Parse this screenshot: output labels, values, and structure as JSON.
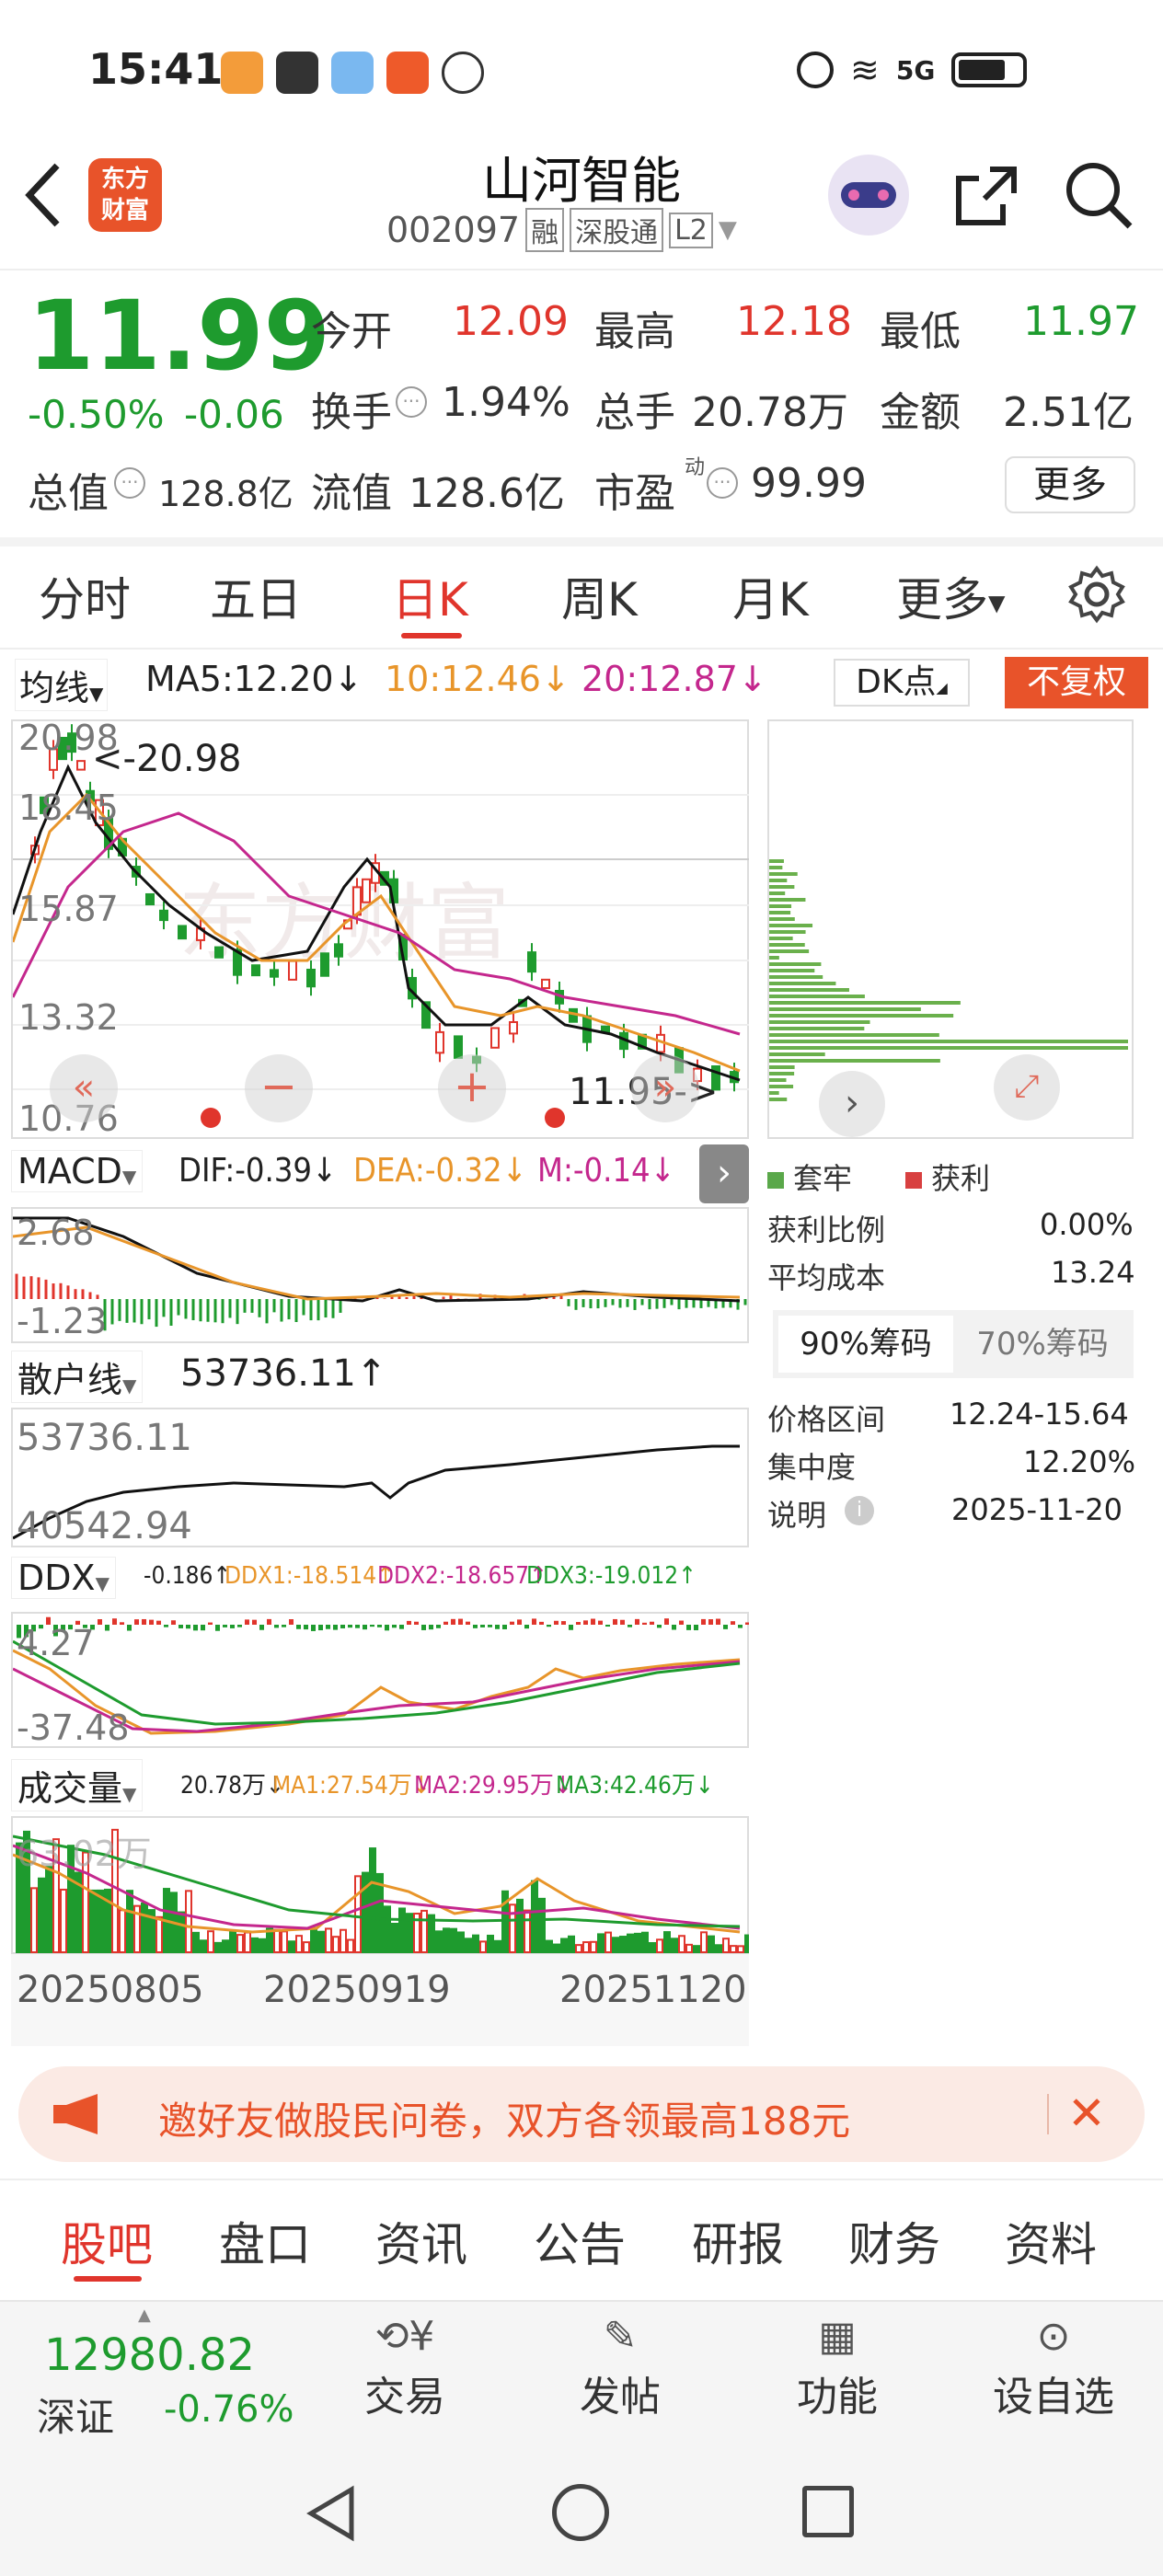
{
  "status_bar": {
    "time": "15:41",
    "net": "5G"
  },
  "header": {
    "back_icon": "back-arrow-icon",
    "brand_logo_line1": "东方",
    "brand_logo_line2": "财富",
    "stock_name": "山河智能",
    "stock_code": "002097",
    "tag_margin": "融",
    "tag_connect": "深股通",
    "tag_level": "L2"
  },
  "quote": {
    "price": "11.99",
    "change_pct": "-0.50%",
    "change_amt": "-0.06",
    "open_label": "今开",
    "open_value": "12.09",
    "high_label": "最高",
    "high_value": "12.18",
    "low_label": "最低",
    "low_value": "11.97",
    "turnover_label": "换手",
    "turnover_value": "1.94%",
    "volume_label": "总手",
    "volume_value": "20.78万",
    "amount_label": "金额",
    "amount_value": "2.51亿",
    "mktcap_label": "总值",
    "mktcap_value": "128.8亿",
    "float_label": "流值",
    "float_value": "128.6亿",
    "pe_label": "市盈",
    "pe_sup": "动",
    "pe_value": "99.99",
    "more_button": "更多"
  },
  "period_tabs": [
    "分时",
    "五日",
    "日K",
    "周K",
    "月K",
    "更多"
  ],
  "period_active_index": 2,
  "ma_bar": {
    "selector": "均线",
    "ma5": "MA5:12.20",
    "ma10": "10:12.46",
    "ma20": "20:12.87",
    "dk_button": "DK点",
    "fq_button": "不复权"
  },
  "kline": {
    "y_labels": [
      "20.98",
      "18.45",
      "15.87",
      "13.32",
      "10.76"
    ],
    "high_marker": "<-20.98",
    "last_marker": "11.95->",
    "watermark": "东方财富"
  },
  "macd": {
    "selector": "MACD",
    "dif": "DIF:-0.39",
    "dea": "DEA:-0.32",
    "m": "M:-0.14",
    "y_top": "2.68",
    "y_bottom": "-1.23"
  },
  "sanhu": {
    "selector": "散户线",
    "value": "53736.11",
    "y_top": "53736.11",
    "y_bottom": "40542.94"
  },
  "ddx": {
    "selector": "DDX",
    "ddx": "-0.186",
    "ddx1": "DDX1:-18.514",
    "ddx2": "DDX2:-18.657",
    "ddx3": "DDX3:-19.012",
    "y_top": "4.27",
    "y_bottom": "-37.48"
  },
  "volume": {
    "selector": "成交量",
    "vol": "20.78万",
    "ma1": "MA1:27.54万",
    "ma2": "MA2:29.95万",
    "ma3": "MA3:42.46万",
    "y_top": "63.02万",
    "dates": [
      "20250805",
      "20250919",
      "20251120"
    ]
  },
  "chips": {
    "legend_trapped": "套牢",
    "legend_profit": "获利",
    "profit_ratio_label": "获利比例",
    "profit_ratio_value": "0.00%",
    "avg_cost_label": "平均成本",
    "avg_cost_value": "13.24",
    "tab_90": "90%筹码",
    "tab_70": "70%筹码",
    "range_label": "价格区间",
    "range_value": "12.24-15.64",
    "concentration_label": "集中度",
    "concentration_value": "12.20%",
    "note_label": "说明",
    "note_value": "2025-11-20"
  },
  "banner": {
    "text": "邀好友做股民问卷，双方各领最高188元"
  },
  "bottom_tabs": [
    "股吧",
    "盘口",
    "资讯",
    "公告",
    "研报",
    "财务",
    "资料"
  ],
  "bottom_tabs_active": 0,
  "index_box": {
    "value": "12980.82",
    "name": "深证",
    "change": "-0.76%"
  },
  "bottom_nav": {
    "trade": "交易",
    "post": "发帖",
    "function": "功能",
    "watch": "设自选"
  },
  "colors": {
    "red": "#e0352c",
    "green": "#1e9b2e",
    "orange": "#e8952a",
    "magenta": "#c4278d"
  }
}
